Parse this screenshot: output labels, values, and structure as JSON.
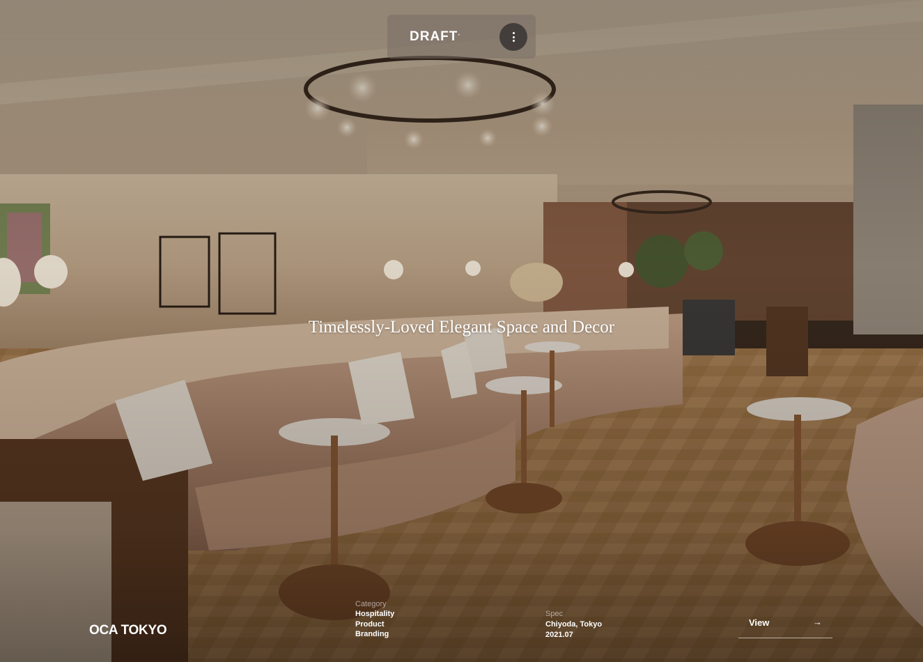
{
  "header": {
    "logo": "DRAFT",
    "logo_mark": "."
  },
  "hero": {
    "headline": "Timelessly-Loved Elegant Space and Decor"
  },
  "project": {
    "title": "OCA TOKYO",
    "category_label": "Category",
    "categories": [
      "Hospitality",
      "Product",
      "Branding"
    ],
    "spec_label": "Spec",
    "spec": [
      "Chiyoda, Tokyo",
      "2021.07"
    ],
    "view_label": "View",
    "view_icon": "arrow-right-icon"
  },
  "colors": {
    "text": "#ffffff",
    "header_bg": "#786e64"
  }
}
